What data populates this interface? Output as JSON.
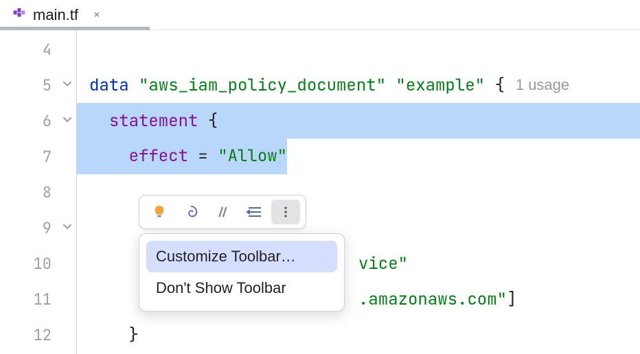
{
  "tab": {
    "filename": "main.tf",
    "close_glyph": "×"
  },
  "gutter": {
    "lines": [
      "4",
      "5",
      "6",
      "7",
      "8",
      "9",
      "10",
      "11",
      "12"
    ]
  },
  "code": {
    "line5": {
      "kw": "data",
      "str1": "\"aws_iam_policy_document\"",
      "str2": "\"example\"",
      "brace": "{",
      "usage": "1 usage"
    },
    "line6": {
      "indent": "  ",
      "prop": "statement",
      "brace": " {"
    },
    "line7": {
      "indent": "    ",
      "prop": "effect",
      "eq": " = ",
      "str": "\"Allow\""
    },
    "line10": {
      "tail_str": "vice\""
    },
    "line11": {
      "tail_str": ".amazonaws.com\"",
      "bracket": "]"
    },
    "line12": {
      "indent": "    ",
      "brace": "}"
    }
  },
  "toolbar": {
    "bulb": "bulb-icon",
    "spiral": "spiral-icon",
    "slash": "slash-icon",
    "reformat": "reformat-icon",
    "more": "more-icon"
  },
  "menu": {
    "item1": "Customize Toolbar…",
    "item2": "Don't Show Toolbar"
  }
}
